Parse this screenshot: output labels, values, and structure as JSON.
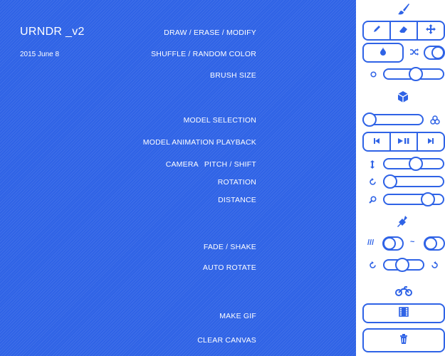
{
  "app": {
    "title": "URNDR _v2",
    "date": "2015 June 8"
  },
  "labels": {
    "draw": "DRAW / ERASE / MODIFY",
    "shuffle": "SHUFFLE / RANDOM COLOR",
    "brush_size": "BRUSH SIZE",
    "model_selection": "MODEL SELECTION",
    "model_playback": "MODEL ANIMATION PLAYBACK",
    "camera": "CAMERA",
    "pitch_shift": "PITCH / SHIFT",
    "rotation": "ROTATION",
    "distance": "DISTANCE",
    "fade_shake": "FADE / SHAKE",
    "auto_rotate": "AUTO ROTATE",
    "make_gif": "MAKE GIF",
    "clear_canvas": "CLEAR CANVAS"
  },
  "glyphs": {
    "fade": "///",
    "shake": "~"
  },
  "controls": {
    "brush_size": 0.55,
    "model_selection": 0.0,
    "pitch_shift": 0.55,
    "rotation": 0.0,
    "distance": 0.8,
    "auto_rotate": 0.45,
    "fade_toggle": 0.0,
    "shake_toggle": 0.0,
    "shuffle_toggle": 1.0
  },
  "colors": {
    "accent": "#2f63e6",
    "canvas": "#2f63e6",
    "panel": "#ffffff"
  },
  "icons": {
    "brush_section": "paintbrush-icon",
    "model_section": "cube-icon",
    "effects_section": "plug-icon",
    "output_section": "motorcycle-icon"
  }
}
